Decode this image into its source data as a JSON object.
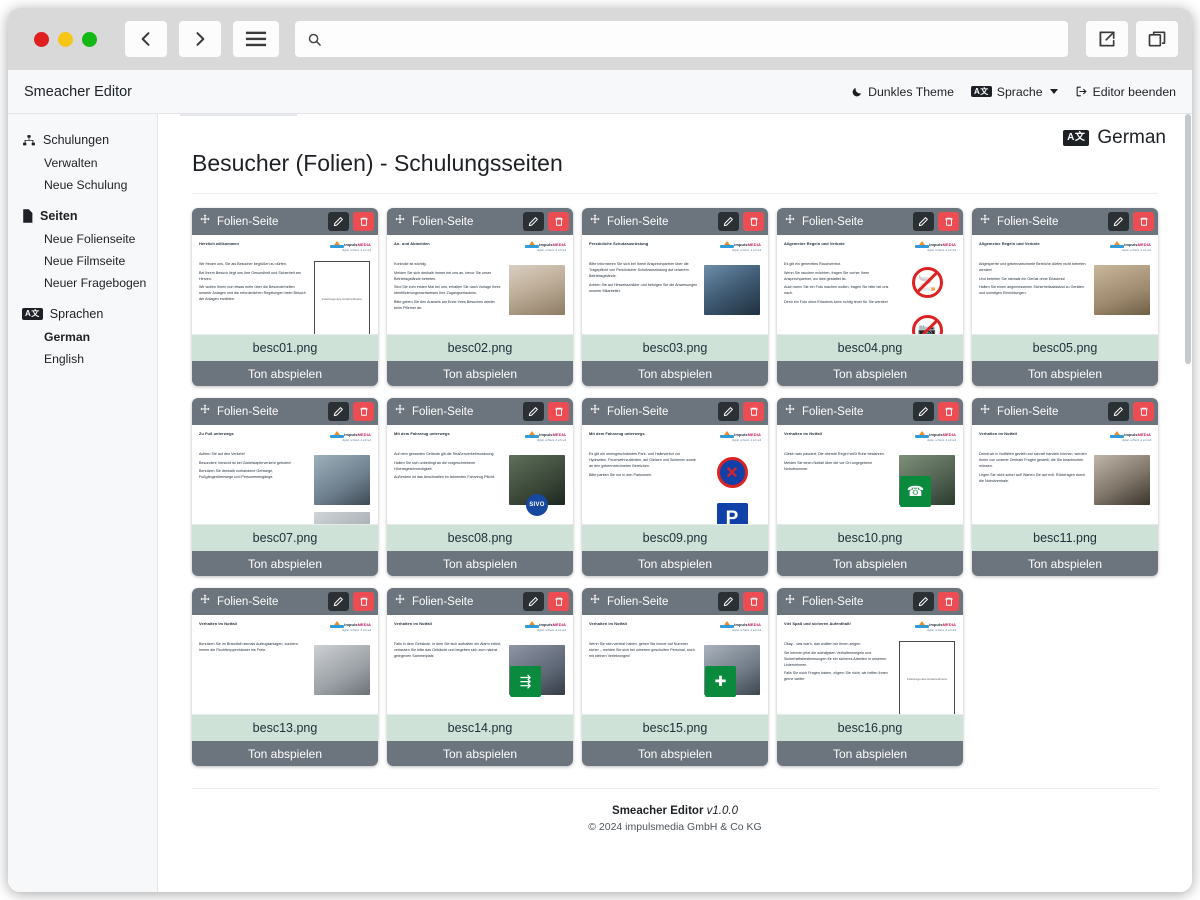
{
  "chrome": {
    "back_icon": "chevron-left-icon",
    "forward_icon": "chevron-right-icon",
    "menu_icon": "hamburger-menu-icon",
    "search_icon": "search-icon",
    "url_value": "",
    "url_placeholder": "",
    "share_icon": "external-link-icon",
    "windows_icon": "duplicate-windows-icon"
  },
  "appbar": {
    "title": "Smeacher Editor",
    "theme_toggle": "Dunkles Theme",
    "language_menu": "Sprache",
    "exit_editor": "Editor beenden"
  },
  "sidebar": {
    "groups": [
      {
        "icon": "sitemap-icon",
        "label": "Schulungen",
        "bold": false,
        "items": [
          {
            "label": "Verwalten",
            "bold": false
          },
          {
            "label": "Neue Schulung",
            "bold": false
          }
        ]
      },
      {
        "icon": "file-icon",
        "label": "Seiten",
        "bold": true,
        "items": [
          {
            "label": "Neue Folienseite",
            "bold": false
          },
          {
            "label": "Neue Filmseite",
            "bold": false
          },
          {
            "label": "Neuer Fragebogen",
            "bold": false
          }
        ]
      },
      {
        "icon": "language-icon",
        "label": "Sprachen",
        "bold": false,
        "items": [
          {
            "label": "German",
            "bold": true
          },
          {
            "label": "English",
            "bold": false
          }
        ]
      }
    ]
  },
  "main": {
    "language_badge": "German",
    "page_title": "Besucher (Folien) - Schulungsseiten",
    "card_type_label": "Folien-Seite",
    "play_label": "Ton abspielen",
    "move_icon": "move-handle-icon",
    "edit_icon": "pencil-icon",
    "delete_icon": "trash-icon",
    "logo_name_1": "impuls",
    "logo_name_2": "MEDIA",
    "logo_tagline": "digital. schlank. & schnell",
    "photo_placeholder": "Foto/Logo des Unternehmens"
  },
  "cards": [
    {
      "filename": "besc01.png",
      "slide_title": "Herzlich willkommen",
      "lines": [
        "Wir freuen uns, Sie als Besucher begrüßen zu dürfen.",
        "Bei Ihrem Besuch liegt uns Ihre Gesundheit und Sicherheit am Herzen.",
        "Wir wollen Ihnen nun etwas mehr über die Besonderheiten unserer Anlagen und die erforderlichen Regelungen beim Besuch der Anlagen erzählen."
      ],
      "media": "placeholder-box"
    },
    {
      "filename": "besc02.png",
      "slide_title": "An- und Abmelden",
      "lines": [
        "Kontrolle ist wichtig.",
        "Melden Sie sich deshalb immer bei uns an, bevor Sie unser Betriebsgelände betreten.",
        "Sind Sie zum ersten Mal bei uns, erhalten Sie nach Vorlage Ihres Identifizierungsnachweises Ihre Zugangserlaubnis.",
        "Bitte geben Sie den Ausweis am Ende Ihres Besuches wieder beim Pförtner ab."
      ],
      "media": "photo-signing"
    },
    {
      "filename": "besc03.png",
      "slide_title": "Persönliche Schutzausrüstung",
      "lines": [
        "Bitte informieren Sie sich bei Ihrem Ansprechpartner über die Tragepflicht von Persönlicher Schutzausrüstung auf unserem Betriebsgelände.",
        "Achten Sie auf Hinweisschilder und befolgen Sie die Anweisungen unserer Mitarbeiter."
      ],
      "media": "photo-ppe"
    },
    {
      "filename": "besc04.png",
      "slide_title": "Allgemeine Regeln und Verbote",
      "lines": [
        "Es gilt ein generelles Rauchverbot.",
        "Wenn Sie rauchen möchten, fragen Sie vorher Ihren Ansprechpartner, wo dies gestattet ist.",
        "Auch wenn Sie ein Foto machen wollen, fragen Sie bitte bei uns nach.",
        "Denn ein Foto ohne Erlaubnis kann richtig teuer für Sie werden!"
      ],
      "media": "signs-no-smoking-no-photo"
    },
    {
      "filename": "besc05.png",
      "slide_title": "Allgemeine Regeln und Verbote",
      "lines": [
        "Abgesperrte und gekennzeichnete Bereiche dürfen nicht betreten werden!",
        "Und betreten Sie niemals ein Gerüst ohne Erlaubnis!",
        "Halten Sie einen angemessenen Sicherheitsabstand zu Geräten und sonstigen Einrichtungen."
      ],
      "media": "photo-barrier-tape"
    },
    {
      "filename": "besc07.png",
      "slide_title": "Zu Fuß unterwegs",
      "lines": [
        "Achten Sie auf den Verkehr!",
        "Besondere Vorsicht ist bei Gabelstaplerverkehr geboten!",
        "Benutzen Sie deshalb vorhandene Gehwege, Fußgängerüberwege und Personeneingänge."
      ],
      "media": "photo-street-and-pedestrian-signs"
    },
    {
      "filename": "besc08.png",
      "slide_title": "Mit dem Fahrzeug unterwegs",
      "lines": [
        "Auf dem gesamten Gelände gilt die Straßenverkehrsordnung.",
        "Halten Sie sich unbedingt an die vorgeschriebene Höchstgeschwindigkeit.",
        "Außerdem ist das Anschnallen im fahrenden Fahrzeug Pflicht."
      ],
      "media": "photo-driver-sivo"
    },
    {
      "filename": "besc09.png",
      "slide_title": "Mit dem Fahrzeug unterwegs",
      "lines": [
        "Es gilt ein uneingeschränktes Park- und Halteverbot vor Hydranten, Feuerwehrzufahrten, auf Gleisen und Schienen sowie an den gekennzeichneten Bereichen.",
        "Bitte parken Sie nur in den Parkzonen."
      ],
      "media": "signs-no-stopping-parking"
    },
    {
      "filename": "besc10.png",
      "slide_title": "Verhalten im Notfall",
      "lines": [
        "Gleich was passiert: Die oberste Regel heißt Ruhe bewahren.",
        "Melden Sie einen Notfall über die vor Ort angegebene Notrufnummer."
      ],
      "media": "photo-emergency-phone"
    },
    {
      "filename": "besc11.png",
      "slide_title": "Verhalten im Notfall",
      "lines": [
        "Damit wir in Notfällen gezielt und schnell handeln können, werden Ihnen von unserer Zentrale Fragen gestellt, die Sie beantworten müssen.",
        "Legen Sie nicht sofort auf! Warten Sie auf evtl. Rückfragen durch die Notrufzentrale."
      ],
      "media": "photo-man-on-phone"
    },
    {
      "filename": "besc13.png",
      "slide_title": "Verhalten im Notfall",
      "lines": [
        "Benutzen Sie im Brandfall niemals Aufzugsanlagen, sondern immer die Fluchttreppenhäuser ins Freie."
      ],
      "media": "photo-no-elevator"
    },
    {
      "filename": "besc14.png",
      "slide_title": "Verhalten im Notfall",
      "lines": [
        "Falls in dem Gebäude, in dem Sie sich aufhalten ein Alarm ertönt, verlassen Sie bitte das Gebäude und begeben sich zum nächst gelegenen Sammelplatz."
      ],
      "media": "photo-assembly-point"
    },
    {
      "filename": "besc15.png",
      "slide_title": "Verhalten im Notfall",
      "lines": [
        "Wenn Sie sich verletzt haben, gehen Sie immer auf Nummer sicher – melden Sie sich bei unserem geschulten Personal, auch mit kleinen Verletzungen!"
      ],
      "media": "photo-first-aid"
    },
    {
      "filename": "besc16.png",
      "slide_title": "Viel Spaß und sicheren Aufenthalt!",
      "lines": [
        "Okay... das war's, das wollten wir Ihnen zeigen.",
        "Sie kennen jetzt die wichtigsten Verhaltensregeln und Sicherheitsbestimmungen für ein sicheres Arbeiten in unserem Unternehmen.",
        "Falls Sie noch Fragen haben, zögern Sie nicht, wir helfen Ihnen gerne weiter."
      ],
      "media": "placeholder-box"
    }
  ],
  "footer": {
    "app": "Smeacher Editor",
    "version": "v1.0.0",
    "copyright": "© 2024 impulsmedia GmbH & Co KG"
  }
}
